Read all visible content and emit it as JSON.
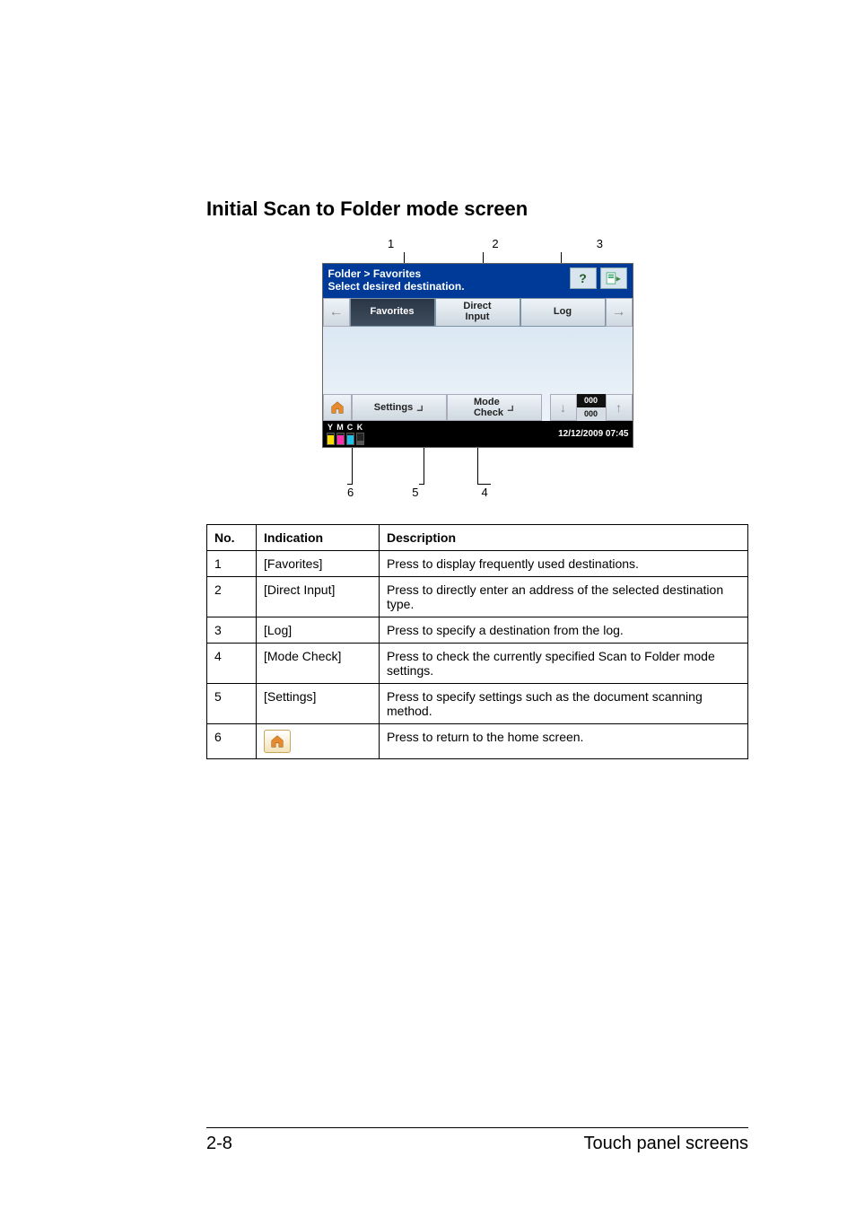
{
  "section_title": "Initial Scan to Folder mode screen",
  "callouts_top": {
    "n1": "1",
    "n2": "2",
    "n3": "3"
  },
  "callouts_bottom": {
    "n4": "4",
    "n5": "5",
    "n6": "6"
  },
  "screen": {
    "breadcrumb": "Folder > Favorites",
    "instruction": "Select desired destination.",
    "help_symbol": "?",
    "tab_favorites": "Favorites",
    "tab_direct_input_l1": "Direct",
    "tab_direct_input_l2": "Input",
    "tab_log": "Log",
    "btn_settings": "Settings",
    "btn_mode_check_l1": "Mode",
    "btn_mode_check_l2": "Check",
    "page_counter_top": "000",
    "page_counter_bot": "000",
    "toner": {
      "y": "Y",
      "m": "M",
      "c": "C",
      "k": "K"
    },
    "datetime": "12/12/2009 07:45"
  },
  "table": {
    "headers": {
      "no": "No.",
      "indication": "Indication",
      "description": "Description"
    },
    "rows": [
      {
        "no": "1",
        "indication": "[Favorites]",
        "description": "Press to display frequently used destinations."
      },
      {
        "no": "2",
        "indication": "[Direct Input]",
        "description": "Press to directly enter an address of the selected destination type."
      },
      {
        "no": "3",
        "indication": "[Log]",
        "description": "Press to specify a destination from the log."
      },
      {
        "no": "4",
        "indication": "[Mode Check]",
        "description": "Press to check the currently specified Scan to Folder mode settings."
      },
      {
        "no": "5",
        "indication": "[Settings]",
        "description": "Press to specify settings such as the document scanning method."
      },
      {
        "no": "6",
        "indication": "",
        "description": "Press to return to the home screen."
      }
    ]
  },
  "footer": {
    "page": "2-8",
    "chapter": "Touch panel screens"
  }
}
